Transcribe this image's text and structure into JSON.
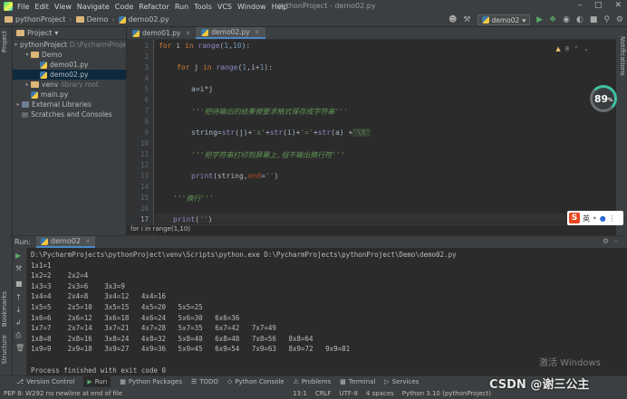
{
  "menubar": {
    "items": [
      "File",
      "Edit",
      "View",
      "Navigate",
      "Code",
      "Refactor",
      "Run",
      "Tools",
      "VCS",
      "Window",
      "Help"
    ],
    "window_title": "pythonProject - demo02.py"
  },
  "toolbar": {
    "breadcrumb": [
      "pythonProject",
      "Demo",
      "demo02.py"
    ],
    "run_config": "demo02"
  },
  "left_strip": {
    "project_tab": "Project",
    "bookmarks_tab": "Bookmarks",
    "structure_tab": "Structure"
  },
  "right_strip": {
    "notifications_tab": "Notifications"
  },
  "project_panel": {
    "title": "Project",
    "tree": [
      {
        "label": "pythonProject",
        "path": "D:\\PycharmProjects",
        "indent": 0,
        "arrow": "▾",
        "icon": "folder-icon"
      },
      {
        "label": "Demo",
        "path": "",
        "indent": 1,
        "arrow": "▾",
        "icon": "folder-icon"
      },
      {
        "label": "demo01.py",
        "path": "",
        "indent": 2,
        "arrow": "",
        "icon": "python-file-icon"
      },
      {
        "label": "demo02.py",
        "path": "",
        "indent": 2,
        "arrow": "",
        "icon": "python-file-icon",
        "selected": true
      },
      {
        "label": "venv",
        "path": "library root",
        "indent": 1,
        "arrow": "▸",
        "icon": "folder-icon"
      },
      {
        "label": "main.py",
        "path": "",
        "indent": 1,
        "arrow": "",
        "icon": "python-file-icon"
      },
      {
        "label": "External Libraries",
        "path": "",
        "indent": 0,
        "arrow": "▸",
        "icon": "library-icon"
      },
      {
        "label": "Scratches and Consoles",
        "path": "",
        "indent": 0,
        "arrow": "",
        "icon": "scratch-icon"
      }
    ]
  },
  "editor": {
    "tabs": [
      {
        "label": "demo01.py",
        "active": false
      },
      {
        "label": "demo02.py",
        "active": true
      }
    ],
    "line_numbers": [
      "1",
      "2",
      "3",
      "4",
      "5",
      "6",
      "7",
      "8",
      "9",
      "10",
      "11",
      "12",
      "13",
      "14",
      "15",
      "16",
      "17"
    ],
    "current_line": "17",
    "inspection_count": "8",
    "breadcrumb_footer": "for i in range(1,10)",
    "lines": [
      "for i in range(1,10):",
      "for j in range(1,i+1):",
      "a=i*j",
      "'''把待输出的结果按要求格式保存成字符串'''",
      "string=str(j)+'x'+str(i)+'='+str(a) +'\\t'",
      "'''把字符串打印到屏幕上,但不输出换行符'''",
      "print(string,end='')",
      "'''换行'''",
      "print('')"
    ]
  },
  "badge": {
    "value": "89",
    "unit": "%"
  },
  "ime": {
    "label": "英"
  },
  "run_panel": {
    "title": "Run:",
    "tab_label": "demo02",
    "console_lines": [
      "D:\\PycharmProjects\\pythonProject\\venv\\Scripts\\python.exe D:\\PycharmProjects\\pythonProject\\Demo\\demo02.py",
      "1x1=1",
      "1x2=2    2x2=4",
      "1x3=3    2x3=6    3x3=9",
      "1x4=4    2x4=8    3x4=12   4x4=16",
      "1x5=5    2x5=10   3x5=15   4x5=20   5x5=25",
      "1x6=6    2x6=12   3x6=18   4x6=24   5x6=30   6x6=36",
      "1x7=7    2x7=14   3x7=21   4x7=28   5x7=35   6x7=42   7x7=49",
      "1x8=8    2x8=16   3x8=24   4x8=32   5x8=40   6x8=48   7x8=56   8x8=64",
      "1x9=9    2x9=18   3x9=27   4x9=36   5x9=45   6x9=54   7x9=63   8x9=72   9x9=81",
      "",
      "Process finished with exit code 0"
    ]
  },
  "bottom_tabs": [
    "Version Control",
    "Run",
    "Python Packages",
    "TODO",
    "Python Console",
    "Problems",
    "Terminal",
    "Services"
  ],
  "status": {
    "message": "PEP 8: W292 no newline at end of file",
    "position": "13:1",
    "line_sep": "CRLF",
    "encoding": "UTF-8",
    "indent": "4 spaces",
    "interpreter": "Python 3.10 (pythonProject)"
  },
  "overlay": {
    "windows_watermark": "激活 Windows",
    "csdn_watermark": "CSDN @谢三公主"
  }
}
